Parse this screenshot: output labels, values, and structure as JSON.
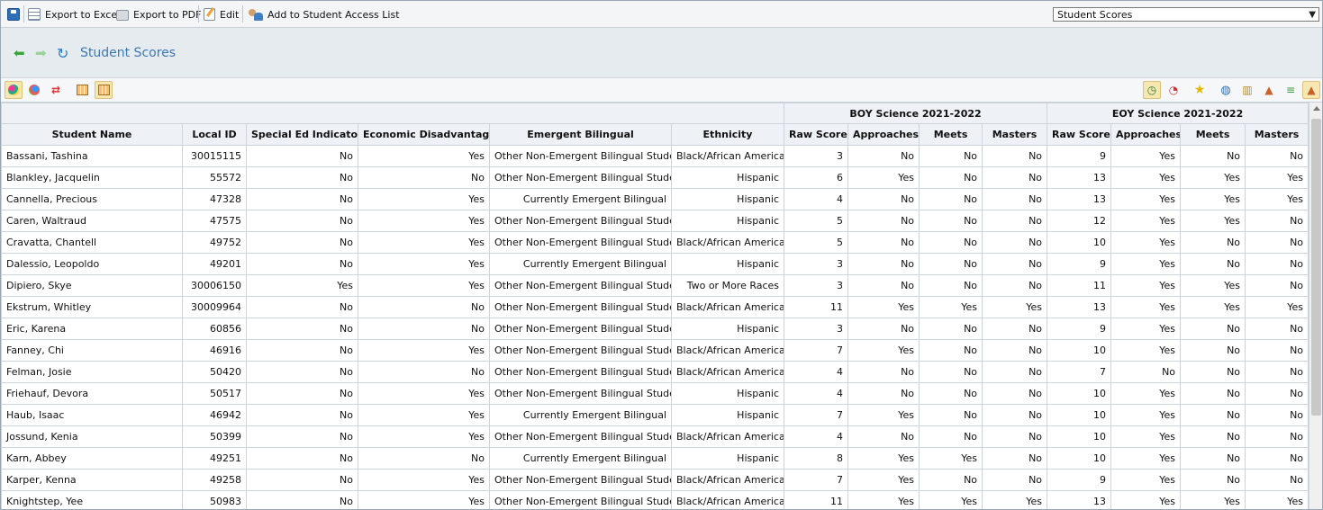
{
  "toolbar": {
    "export_excel": "Export to Excel",
    "export_pdf": "Export to PDF",
    "edit": "Edit",
    "add_access": "Add to Student Access List"
  },
  "report_select": {
    "value": "Student Scores"
  },
  "header": {
    "title": "Student Scores"
  },
  "table": {
    "groups": [
      "BOY Science 2021-2022",
      "EOY Science 2021-2022"
    ],
    "columns": [
      "Student Name",
      "Local ID",
      "Special Ed Indicator",
      "Economic Disadvantage",
      "Emergent Bilingual",
      "Ethnicity",
      "Raw Score",
      "Approaches",
      "Meets",
      "Masters",
      "Raw Score",
      "Approaches",
      "Meets",
      "Masters"
    ],
    "rows": [
      [
        "Bassani, Tashina",
        "30015115",
        "No",
        "Yes",
        "Other Non-Emergent Bilingual Student",
        "Black/African American",
        "3",
        "No",
        "No",
        "No",
        "9",
        "Yes",
        "No",
        "No"
      ],
      [
        "Blankley, Jacquelin",
        "55572",
        "No",
        "No",
        "Other Non-Emergent Bilingual Student",
        "Hispanic",
        "6",
        "Yes",
        "No",
        "No",
        "13",
        "Yes",
        "Yes",
        "Yes"
      ],
      [
        "Cannella, Precious",
        "47328",
        "No",
        "Yes",
        "Currently Emergent Bilingual",
        "Hispanic",
        "4",
        "No",
        "No",
        "No",
        "13",
        "Yes",
        "Yes",
        "Yes"
      ],
      [
        "Caren, Waltraud",
        "47575",
        "No",
        "Yes",
        "Other Non-Emergent Bilingual Student",
        "Hispanic",
        "5",
        "No",
        "No",
        "No",
        "12",
        "Yes",
        "Yes",
        "No"
      ],
      [
        "Cravatta, Chantell",
        "49752",
        "No",
        "Yes",
        "Other Non-Emergent Bilingual Student",
        "Black/African American",
        "5",
        "No",
        "No",
        "No",
        "10",
        "Yes",
        "No",
        "No"
      ],
      [
        "Dalessio, Leopoldo",
        "49201",
        "No",
        "Yes",
        "Currently Emergent Bilingual",
        "Hispanic",
        "3",
        "No",
        "No",
        "No",
        "9",
        "Yes",
        "No",
        "No"
      ],
      [
        "Dipiero, Skye",
        "30006150",
        "Yes",
        "Yes",
        "Other Non-Emergent Bilingual Student",
        "Two or More Races",
        "3",
        "No",
        "No",
        "No",
        "11",
        "Yes",
        "Yes",
        "No"
      ],
      [
        "Ekstrum, Whitley",
        "30009964",
        "No",
        "No",
        "Other Non-Emergent Bilingual Student",
        "Black/African American",
        "11",
        "Yes",
        "Yes",
        "Yes",
        "13",
        "Yes",
        "Yes",
        "Yes"
      ],
      [
        "Eric, Karena",
        "60856",
        "No",
        "No",
        "Other Non-Emergent Bilingual Student",
        "Hispanic",
        "3",
        "No",
        "No",
        "No",
        "9",
        "Yes",
        "No",
        "No"
      ],
      [
        "Fanney, Chi",
        "46916",
        "No",
        "Yes",
        "Other Non-Emergent Bilingual Student",
        "Black/African American",
        "7",
        "Yes",
        "No",
        "No",
        "10",
        "Yes",
        "No",
        "No"
      ],
      [
        "Felman, Josie",
        "50420",
        "No",
        "No",
        "Other Non-Emergent Bilingual Student",
        "Black/African American",
        "4",
        "No",
        "No",
        "No",
        "7",
        "No",
        "No",
        "No"
      ],
      [
        "Friehauf, Devora",
        "50517",
        "No",
        "Yes",
        "Other Non-Emergent Bilingual Student",
        "Hispanic",
        "4",
        "No",
        "No",
        "No",
        "10",
        "Yes",
        "No",
        "No"
      ],
      [
        "Haub, Isaac",
        "46942",
        "No",
        "Yes",
        "Currently Emergent Bilingual",
        "Hispanic",
        "7",
        "Yes",
        "No",
        "No",
        "10",
        "Yes",
        "No",
        "No"
      ],
      [
        "Jossund, Kenia",
        "50399",
        "No",
        "Yes",
        "Other Non-Emergent Bilingual Student",
        "Black/African American",
        "4",
        "No",
        "No",
        "No",
        "10",
        "Yes",
        "No",
        "No"
      ],
      [
        "Karn, Abbey",
        "49251",
        "No",
        "No",
        "Currently Emergent Bilingual",
        "Hispanic",
        "8",
        "Yes",
        "Yes",
        "No",
        "10",
        "Yes",
        "No",
        "No"
      ],
      [
        "Karper, Kenna",
        "49258",
        "No",
        "Yes",
        "Other Non-Emergent Bilingual Student",
        "Black/African American",
        "7",
        "Yes",
        "No",
        "No",
        "9",
        "Yes",
        "No",
        "No"
      ],
      [
        "Knightstep, Yee",
        "50983",
        "No",
        "Yes",
        "Other Non-Emergent Bilingual Student",
        "Black/African American",
        "11",
        "Yes",
        "Yes",
        "Yes",
        "13",
        "Yes",
        "Yes",
        "Yes"
      ]
    ]
  }
}
